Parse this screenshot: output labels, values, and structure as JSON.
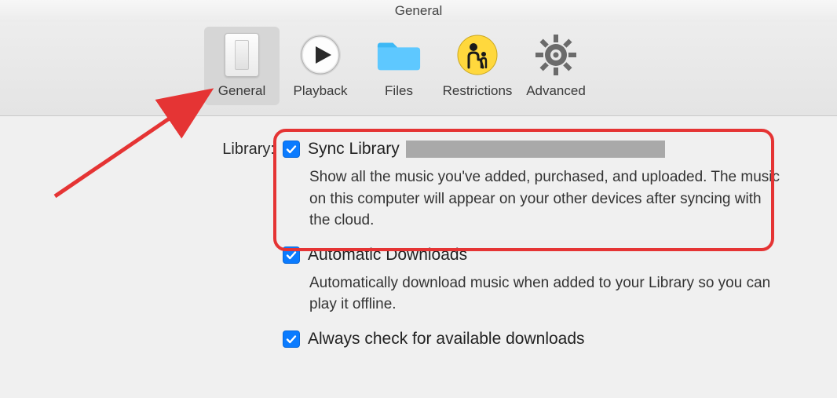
{
  "window": {
    "title": "General"
  },
  "tabs": [
    {
      "id": "general",
      "label": "General",
      "selected": true
    },
    {
      "id": "playback",
      "label": "Playback",
      "selected": false
    },
    {
      "id": "files",
      "label": "Files",
      "selected": false
    },
    {
      "id": "restrictions",
      "label": "Restrictions",
      "selected": false
    },
    {
      "id": "advanced",
      "label": "Advanced",
      "selected": false
    }
  ],
  "section_label": "Library:",
  "options": [
    {
      "id": "sync-library",
      "checked": true,
      "label": "Sync Library",
      "highlighted": true,
      "description": "Show all the music you've added, purchased, and uploaded. The music on this computer will appear on your other devices after syncing with the cloud."
    },
    {
      "id": "automatic-downloads",
      "checked": true,
      "label": "Automatic Downloads",
      "highlighted": false,
      "description": "Automatically download music when added to your Library so you can play it offline."
    },
    {
      "id": "always-check-downloads",
      "checked": true,
      "label": "Always check for available downloads",
      "highlighted": false,
      "description": ""
    }
  ],
  "annotation": {
    "arrow_target_tab": "general"
  }
}
